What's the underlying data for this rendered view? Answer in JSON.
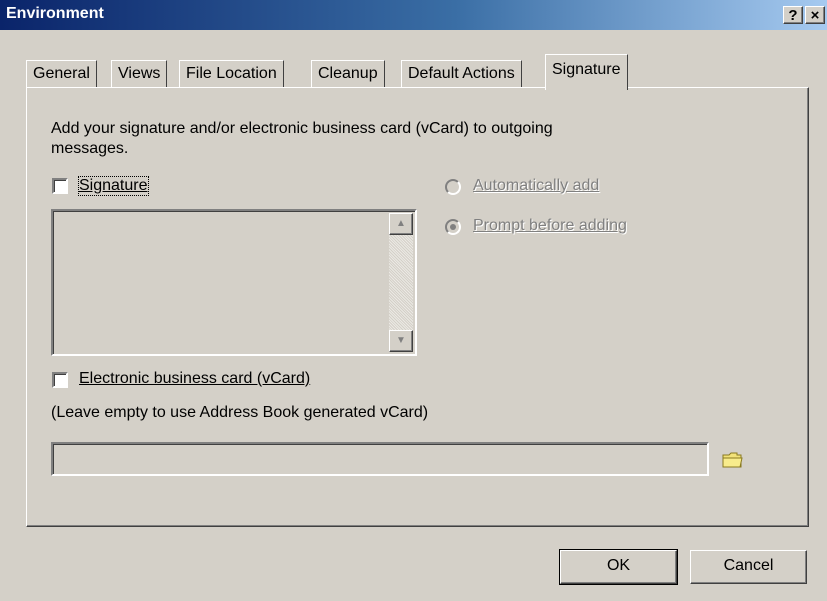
{
  "window": {
    "title": "Environment",
    "help_button": "?",
    "close_button": "×"
  },
  "tabs": [
    {
      "label": "General"
    },
    {
      "label": "Views"
    },
    {
      "label": "File Location"
    },
    {
      "label": "Cleanup"
    },
    {
      "label": "Default Actions"
    },
    {
      "label": "Signature",
      "active": true
    }
  ],
  "signature_panel": {
    "description": "Add your signature and/or electronic business card (vCard) to outgoing messages.",
    "description_line1": "Add your signature and/or electronic business card (vCard) to outgoing",
    "description_line2": "messages.",
    "signature_checkbox": {
      "label": "Signature",
      "checked": false
    },
    "signature_text": "",
    "radio_auto": {
      "label": "Automatically add",
      "selected": false,
      "enabled": false
    },
    "radio_prompt": {
      "label": "Prompt before adding",
      "selected": true,
      "enabled": false
    },
    "vcard_checkbox": {
      "label": "Electronic business card (vCard)",
      "checked": false
    },
    "vcard_hint": "(Leave empty to use Address Book generated vCard)",
    "vcard_path": ""
  },
  "footer": {
    "ok_label": "OK",
    "cancel_label": "Cancel"
  },
  "icons": {
    "browse": "folder-icon"
  },
  "colors": {
    "titlebar_start": "#0a246a",
    "titlebar_end": "#a6caf0",
    "face": "#d4d0c8"
  }
}
